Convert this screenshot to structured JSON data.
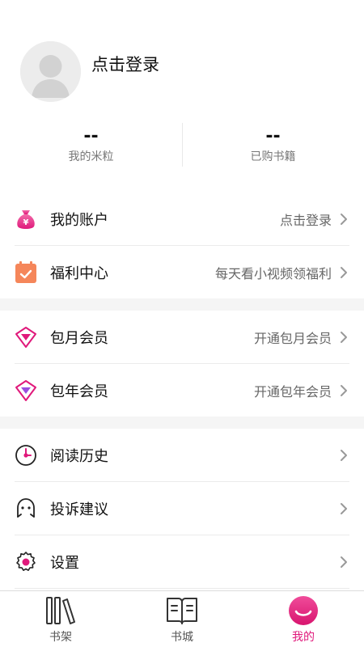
{
  "profile": {
    "login_prompt": "点击登录",
    "avatar_icon": "default-avatar-icon"
  },
  "stats": [
    {
      "value": "--",
      "label": "我的米粒"
    },
    {
      "value": "--",
      "label": "已购书籍"
    }
  ],
  "menu_group_1": [
    {
      "icon": "money-bag-icon",
      "title": "我的账户",
      "right": "点击登录"
    },
    {
      "icon": "calendar-check-icon",
      "title": "福利中心",
      "right": "每天看小视频领福利"
    }
  ],
  "menu_group_2": [
    {
      "icon": "diamond-monthly-icon",
      "title": "包月会员",
      "right": "开通包月会员"
    },
    {
      "icon": "diamond-yearly-icon",
      "title": "包年会员",
      "right": "开通包年会员"
    }
  ],
  "menu_group_3": [
    {
      "icon": "clock-icon",
      "title": "阅读历史",
      "right": ""
    },
    {
      "icon": "smiley-face-icon",
      "title": "投诉建议",
      "right": ""
    },
    {
      "icon": "gear-icon",
      "title": "设置",
      "right": ""
    }
  ],
  "tabbar": [
    {
      "icon": "bookshelf-icon",
      "label": "书架",
      "active": false
    },
    {
      "icon": "open-book-icon",
      "label": "书城",
      "active": false
    },
    {
      "icon": "smiley-avatar-icon",
      "label": "我的",
      "active": true
    }
  ],
  "colors": {
    "accent": "#e0197b",
    "menu_orange": "#f5865a",
    "divider": "#ebebeb",
    "section_gap": "#f5f5f5",
    "text_secondary": "#666666"
  }
}
